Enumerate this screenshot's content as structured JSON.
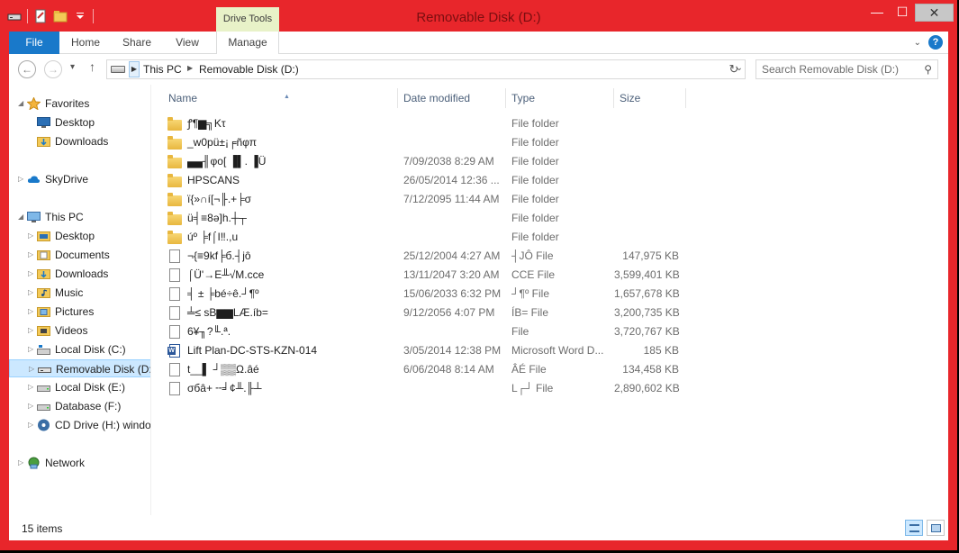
{
  "window": {
    "title": "Removable Disk (D:)",
    "contextual_tab": "Drive Tools",
    "controls": {
      "minimize": "—",
      "maximize": "☐",
      "close": "✕"
    }
  },
  "qat": {
    "icons": [
      "drive-icon",
      "properties-icon",
      "new-folder-icon",
      "customize-dropdown-icon"
    ]
  },
  "ribbon": {
    "tabs": [
      "File",
      "Home",
      "Share",
      "View",
      "Manage"
    ]
  },
  "address": {
    "back": "←",
    "forward": "→",
    "up": "↑",
    "crumbs": [
      "This PC",
      "Removable Disk (D:)"
    ],
    "search_placeholder": "Search Removable Disk (D:)"
  },
  "navpane": {
    "items": [
      {
        "label": "Favorites",
        "icon": "star-icon",
        "indent": 0,
        "expander": "◢"
      },
      {
        "label": "Desktop",
        "icon": "desktop-icon",
        "indent": 1
      },
      {
        "label": "Downloads",
        "icon": "downloads-icon",
        "indent": 1
      },
      {
        "label": "SkyDrive",
        "icon": "cloud-icon",
        "indent": 0,
        "expander": "▷"
      },
      {
        "label": "This PC",
        "icon": "computer-icon",
        "indent": 0,
        "expander": "◢"
      },
      {
        "label": "Desktop",
        "icon": "desktop-folder-icon",
        "indent": 1,
        "expander": "▷"
      },
      {
        "label": "Documents",
        "icon": "documents-icon",
        "indent": 1,
        "expander": "▷"
      },
      {
        "label": "Downloads",
        "icon": "downloads-icon",
        "indent": 1,
        "expander": "▷"
      },
      {
        "label": "Music",
        "icon": "music-icon",
        "indent": 1,
        "expander": "▷"
      },
      {
        "label": "Pictures",
        "icon": "pictures-icon",
        "indent": 1,
        "expander": "▷"
      },
      {
        "label": "Videos",
        "icon": "videos-icon",
        "indent": 1,
        "expander": "▷"
      },
      {
        "label": "Local Disk (C:)",
        "icon": "windows-drive-icon",
        "indent": 1,
        "expander": "▷"
      },
      {
        "label": "Removable Disk (D:)",
        "icon": "removable-drive-icon",
        "indent": 1,
        "expander": "▷",
        "selected": true
      },
      {
        "label": "Local Disk (E:)",
        "icon": "drive-icon",
        "indent": 1,
        "expander": "▷"
      },
      {
        "label": "Database (F:)",
        "icon": "drive-icon",
        "indent": 1,
        "expander": "▷"
      },
      {
        "label": "CD Drive (H:) windo",
        "icon": "cd-drive-icon",
        "indent": 1,
        "expander": "▷"
      },
      {
        "label": "Network",
        "icon": "network-icon",
        "indent": 0,
        "expander": "▷"
      }
    ]
  },
  "columns": {
    "name": "Name",
    "date": "Date modified",
    "type": "Type",
    "size": "Size"
  },
  "files": [
    {
      "name": "ꝭ¶▆╗Kτ",
      "date": "",
      "type": "File folder",
      "size": "",
      "kind": "folder"
    },
    {
      "name": "_w0pü±¡╒ñφπ",
      "date": "",
      "type": "File folder",
      "size": "",
      "kind": "folder"
    },
    {
      "name": "▄▄╢φo[ ▐▌. ▐Ü",
      "date": "7/09/2038 8:29 AM",
      "type": "File folder",
      "size": "",
      "kind": "folder"
    },
    {
      "name": "HPSCANS",
      "date": "26/05/2014 12:36 ...",
      "type": "File folder",
      "size": "",
      "kind": "folder"
    },
    {
      "name": "ï{»∩í[¬╟.+╞σ",
      "date": "7/12/2095 11:44 AM",
      "type": "File folder",
      "size": "",
      "kind": "folder"
    },
    {
      "name": "ü╡≡8ǝ]h.┼┬",
      "date": "",
      "type": "File folder",
      "size": "",
      "kind": "folder"
    },
    {
      "name": "úº ╞f⌠I‼.,u",
      "date": "",
      "type": "File folder",
      "size": "",
      "kind": "folder"
    },
    {
      "name": "¬{≡9kf╞б.┤jô",
      "date": "25/12/2004 4:27 AM",
      "type": "┤JÔ File",
      "size": "147,975 KB",
      "kind": "file"
    },
    {
      "name": "⌠Ü'→E╨√M.cce",
      "date": "13/11/2047 3:20 AM",
      "type": "CCE File",
      "size": "3,599,401 KB",
      "kind": "file"
    },
    {
      "name": "╡ ± ╞bé÷ê.┘¶º",
      "date": "15/06/2033 6:32 PM",
      "type": "┘¶º File",
      "size": "1,657,678 KB",
      "kind": "file"
    },
    {
      "name": "╧≤ sB▆▆LÆ.íb=",
      "date": "9/12/2056 4:07 PM",
      "type": "ÍB= File",
      "size": "3,200,735 KB",
      "kind": "file"
    },
    {
      "name": "6¥╖?╙.ª.",
      "date": "",
      "type": "File",
      "size": "3,720,767 KB",
      "kind": "file"
    },
    {
      "name": "Lift Plan-DC-STS-KZN-014",
      "date": "3/05/2014 12:38 PM",
      "type": "Microsoft Word D...",
      "size": "185 KB",
      "kind": "word"
    },
    {
      "name": "t__▌ ┘▒▒Ω.âé",
      "date": "6/06/2048 8:14 AM",
      "type": "ÂÉ File",
      "size": "134,458 KB",
      "kind": "file"
    },
    {
      "name": "σбâ+ ╌╛¢╨.╟┴",
      "date": "",
      "type": "L┌┘ File",
      "size": "2,890,602 KB",
      "kind": "file"
    }
  ],
  "status": {
    "count_text": "15 items"
  },
  "colors": {
    "accent": "#1979ca",
    "frame": "#e8262b",
    "contextual": "#e8f2c8",
    "selection": "#cce8ff"
  }
}
